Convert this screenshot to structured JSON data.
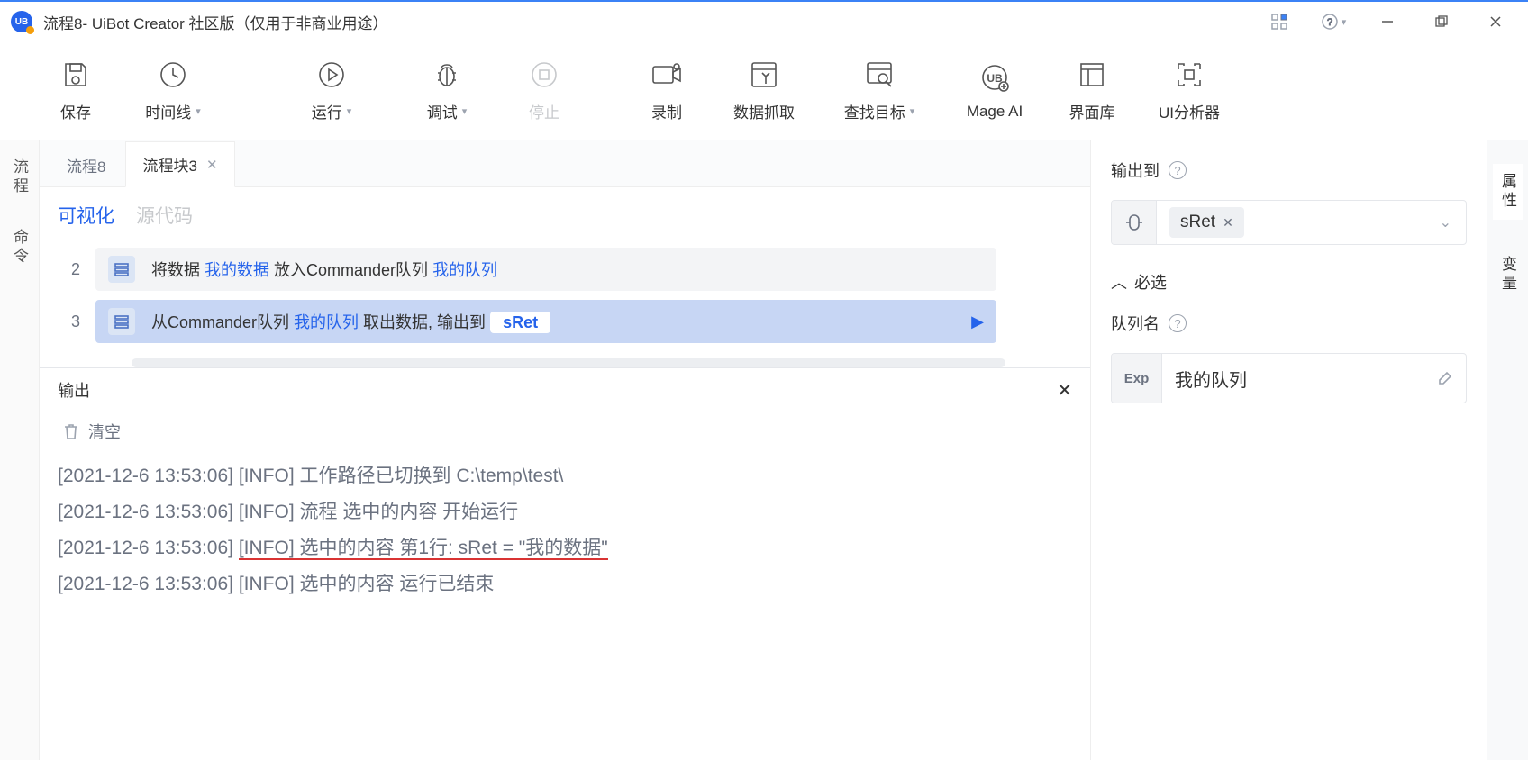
{
  "titlebar": {
    "title": "流程8- UiBot Creator 社区版（仅用于非商业用途）"
  },
  "toolbar": {
    "save": "保存",
    "timeline": "时间线",
    "run": "运行",
    "debug": "调试",
    "stop": "停止",
    "record": "录制",
    "scrape": "数据抓取",
    "findtarget": "查找目标",
    "mageai": "Mage AI",
    "uilib": "界面库",
    "uianalyzer": "UI分析器"
  },
  "leftrail": {
    "flow": "流程",
    "cmd": "命令"
  },
  "tabs": {
    "t1": "流程8",
    "t2": "流程块3"
  },
  "viewmode": {
    "visual": "可视化",
    "source": "源代码"
  },
  "steps": {
    "row2num": "2",
    "row2_a": "将数据 ",
    "row2_b": "我的数据",
    "row2_c": " 放入Commander队列 ",
    "row2_d": "我的队列",
    "row3num": "3",
    "row3_a": "从Commander队列 ",
    "row3_b": "我的队列",
    "row3_c": " 取出数据, 输出到",
    "row3_chip": "sRet"
  },
  "output": {
    "title": "输出",
    "clear": "清空",
    "l1_a": "[2021-12-6 13:53:06] [INFO] ",
    "l1_b": "工作路径已切换到 C:\\temp\\test\\",
    "l2_a": "[2021-12-6 13:53:06] [INFO] ",
    "l2_b": "流程 选中的内容 开始运行",
    "l3_a": "[2021-12-6 13:53:06] ",
    "l3_b": "[INFO] ",
    "l3_c": "选中的内容 第1行: sRet = \"我的数据\"",
    "l4_a": "[2021-12-6 13:53:06] [INFO] ",
    "l4_b": "选中的内容 运行已结束"
  },
  "props": {
    "outputto": "输出到",
    "var": "sRet",
    "required": "必选",
    "queuename": "队列名",
    "expbadge": "Exp",
    "queueval": "我的队列"
  },
  "rightrail": {
    "attr": "属性",
    "vars": "变量"
  }
}
